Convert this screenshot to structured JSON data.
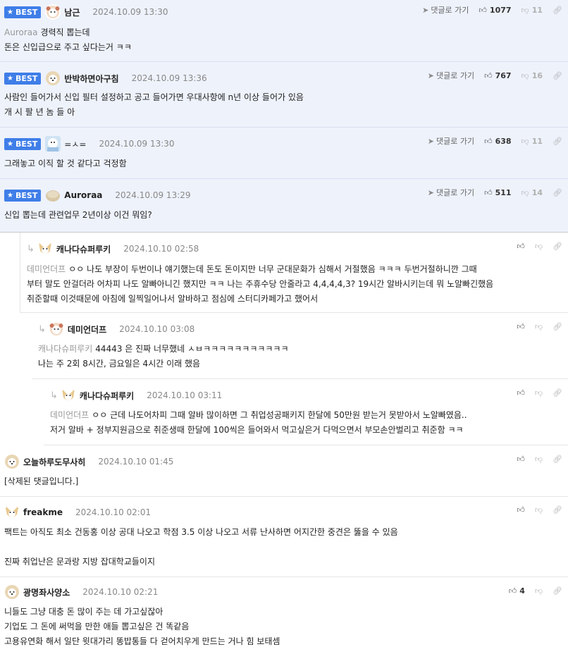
{
  "badge_label": "BEST",
  "goto_label": "댓글로 가기",
  "comments": [
    {
      "nick": "남근",
      "date": "2024.10.09 13:30",
      "up": "1077",
      "down": "11",
      "ref": "Auroraa",
      "lines": [
        "경력직 뽑는데",
        "돈은 신입급으로 주고 싶다는거 ㅋㅋ"
      ]
    },
    {
      "nick": "반박하면아구침",
      "date": "2024.10.09 13:36",
      "up": "767",
      "down": "16",
      "lines": [
        "사람인 들어가서 신입 필터 설정하고 공고 들어가면 우대사항에 n년 이상 들어가 있음",
        "개 시 팔 년 놈 들 아"
      ]
    },
    {
      "nick": "=ㅅ=",
      "date": "2024.10.09 13:30",
      "up": "638",
      "down": "11",
      "lines": [
        "그래놓고 이직 할 것 같다고 걱정함"
      ]
    },
    {
      "nick": "Auroraa",
      "date": "2024.10.09 13:29",
      "up": "511",
      "down": "14",
      "lines": [
        "신입 뽑는데 관련업무 2년이상 이건 뭐임?"
      ]
    },
    {
      "nick": "캐나다슈퍼루키",
      "date": "2024.10.10 02:58",
      "ref": "데미언더프",
      "lines": [
        "ㅇㅇ 나도 부장이 두번이나 얘기했는데 돈도 돈이지만 너무 군대문화가 심해서 거절했음 ㅋㅋㅋ 두번거절하니깐 그때",
        "부터 말도 안걸더라 어차피 나도 알빠아니긴 했지만 ㅋㅋ 나는 주휴수당 안줄라고 4,4,4,4,3? 19시간 알바시키는데 뭐 노알빠긴했음",
        "취준할때 이것때문에 아침에 일찍일어나서 알바하고 점심에 스터디카페가고 했어서"
      ]
    },
    {
      "nick": "데미언더프",
      "date": "2024.10.10 03:08",
      "ref": "캐나다슈퍼루키",
      "lines": [
        "44443 은 진짜 너무했네 ㅅㅂㅋㅋㅋㅋㅋㅋㅋㅋㅋㅋㅋ",
        "나는 주 2회 8시간, 금요일은 4시간 이래 했음"
      ]
    },
    {
      "nick": "캐나다슈퍼루키",
      "date": "2024.10.10 03:11",
      "ref": "데미언더프",
      "lines": [
        "ㅇㅇ 근데 나도어차피 그때 알바 많이하면 그 취업성공패키지 한달에 50만원 받는거 못받아서 노알빠였음..",
        "저거 알바 + 정부지원금으로 취준생때 한달에 100씩은 들어와서 먹고싶은거 다먹으면서 부모손안벌리고 취준함 ㅋㅋ"
      ]
    },
    {
      "nick": "오늘하루도무사히",
      "date": "2024.10.10 01:45",
      "lines": [
        "[삭제된 댓글입니다.]"
      ]
    },
    {
      "nick": "freakme",
      "date": "2024.10.10 02:01",
      "lines": [
        "팩트는 아직도 최소 건동홍 이상 공대 나오고 학점 3.5 이상 나오고 서류 난사하면 어지간한 중견은 뚫을 수 있음",
        "",
        "진짜 취업난은 문과랑 지방 잡대학교들이지"
      ]
    },
    {
      "nick": "광명좌사양소",
      "date": "2024.10.10 02:21",
      "up": "4",
      "lines": [
        "니들도 그냥 대충 돈 많이 주는 데 가고싶잖아",
        "기업도 그 돈에 써먹을 만한 애들 뽑고싶은 건 똑같음",
        "고용유연화 해서 일단 윗대가리 똥밥통들 다 걷어치우게 만드는 거나 힘 보태셈"
      ]
    }
  ]
}
